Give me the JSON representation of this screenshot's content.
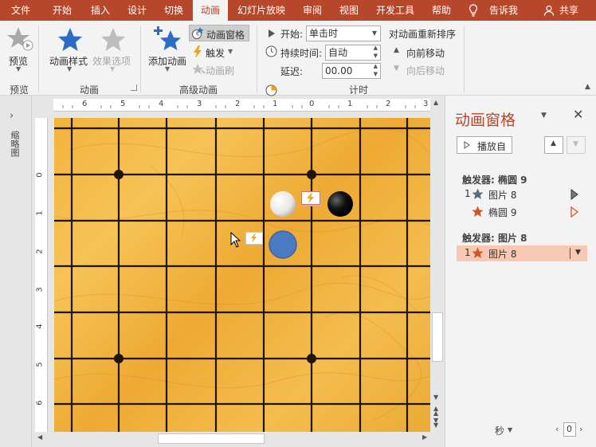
{
  "menu": {
    "items": [
      "文件",
      "开始",
      "插入",
      "设计",
      "切换",
      "动画",
      "幻灯片放映",
      "审阅",
      "视图",
      "开发工具",
      "帮助"
    ],
    "active_index": 5,
    "tell_me": "告诉我",
    "share": "共享"
  },
  "ribbon": {
    "preview_btn": "预览",
    "preview_group": "预览",
    "anim_style_btn": "动画样式",
    "effect_options_btn": "效果选项",
    "anim_group": "动画",
    "add_anim_btn": "添加动画",
    "anim_pane_btn": "动画窗格",
    "trigger_btn": "触发",
    "anim_painter_btn": "动画刷",
    "adv_group": "高级动画",
    "start_label": "开始:",
    "start_value": "单击时",
    "duration_label": "持续时间:",
    "duration_value": "自动",
    "delay_label": "延迟:",
    "delay_value": "00.00",
    "reorder_label": "对动画重新排序",
    "move_earlier": "向前移动",
    "move_later": "向后移动",
    "timing_group": "计时"
  },
  "left_pane": {
    "label": "缩略图"
  },
  "rulers": {
    "h_ticks": [
      "6",
      "5",
      "4",
      "3",
      "2",
      "1",
      "0",
      "1",
      "2",
      "3"
    ],
    "v_ticks": [
      "0",
      "1",
      "2",
      "3",
      "4",
      "5",
      "6"
    ]
  },
  "anim_pane": {
    "title": "动画窗格",
    "play_btn": "播放自",
    "trigger1_label": "触发器: 椭圆 9",
    "trigger1_items": [
      {
        "num": "1",
        "name": "图片 8"
      },
      {
        "num": "",
        "name": "椭圆 9"
      }
    ],
    "trigger2_label": "触发器: 图片 8",
    "trigger2_items": [
      {
        "num": "1",
        "name": "图片 8"
      }
    ],
    "timeline_unit": "秒",
    "timeline_value": "0"
  },
  "colors": {
    "accent": "#b7472a",
    "star_gray": "#5a6b80",
    "star_orange": "#c8572a",
    "star_blue": "#2b6cc4",
    "board_line": "#1e1408",
    "blue_stone": "#4a7ac2",
    "selected_row": "#f9c8b2"
  }
}
